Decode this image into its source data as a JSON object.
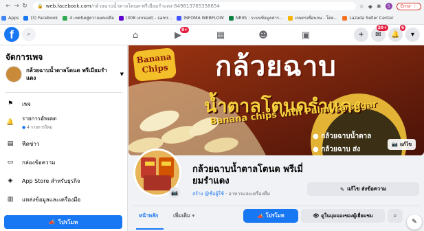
{
  "browser": {
    "url_host": "web.facebook.com",
    "url_path": "/กล้วยฉาบน้ำตาลโตนด-พรีเมียมรำแดง-849813765358654",
    "error_label": "Error",
    "profile_initial": "S"
  },
  "bookmarks": [
    {
      "label": "Apps",
      "color": "#4285f4"
    },
    {
      "label": "(3) Facebook",
      "color": "#1877f2"
    },
    {
      "label": "4 เทคนิคสู่ความผลเหลือ",
      "color": "#34a853"
    },
    {
      "label": "(308 unread) - samr...",
      "color": "#6001d2"
    },
    {
      "label": "INFOMA WEBFLOW",
      "color": "#4353ff"
    },
    {
      "label": "NRIIS : ระบบข้อมูลสาร...",
      "color": "#0b8043"
    },
    {
      "label": "เกษตรเพื่อนกษ - โดย...",
      "color": "#f4b400"
    },
    {
      "label": "Lazada Seller Center",
      "color": "#f57224"
    }
  ],
  "fb": {
    "logo": "f",
    "nav_badge_watch": "9+",
    "badge_messenger": "20+",
    "badge_notifications": "6"
  },
  "sidebar": {
    "title": "จัดการเพจ",
    "page_name": "กล้วยฉาบน้ำตาลโตนด พรีเมียมรำแดง",
    "items": [
      {
        "label": "เพจ",
        "sub": ""
      },
      {
        "label": "รายการอัพเดต",
        "sub": "4 รายการใหม่"
      },
      {
        "label": "ฟีดข่าว",
        "sub": ""
      },
      {
        "label": "กล่องข้อความ",
        "sub": ""
      },
      {
        "label": "App Store สำหรับธุรกิจ",
        "sub": ""
      },
      {
        "label": "แหล่งข้อมูลและเครื่องมือ",
        "sub": ""
      }
    ],
    "promote_label": "โปรโมท"
  },
  "cover": {
    "edit_label": "แก้ไข",
    "badge_line1": "Banana",
    "badge_line2": "Chips",
    "headline1": "กล้วยฉาบ",
    "headline2": "น้ำตาลโตนดรำแดง",
    "tagline": "Banana chips with Palmyra sugar",
    "bullet1": "● กล้วยฉาบน้ำตาล",
    "bullet2": "● กล้วยฉาบ ส่ง"
  },
  "page": {
    "title": "กล้วยฉาบน้ำตาลโตนด พรีเมี่ยมรำแดง",
    "cta_link": "สร้าง @ชื่อผู้ใช้",
    "category": " · อาหารและเครื่องดื่ม",
    "edit_cta_label": "แก้ไข ส่งข้อความ"
  },
  "tabs": {
    "home": "หน้าหลัก",
    "more": "เพิ่มเติม ▾"
  },
  "actions": {
    "promote": "โปรโมท",
    "view_as": "ดูในมุมมองของผู้เยี่ยมชม"
  }
}
